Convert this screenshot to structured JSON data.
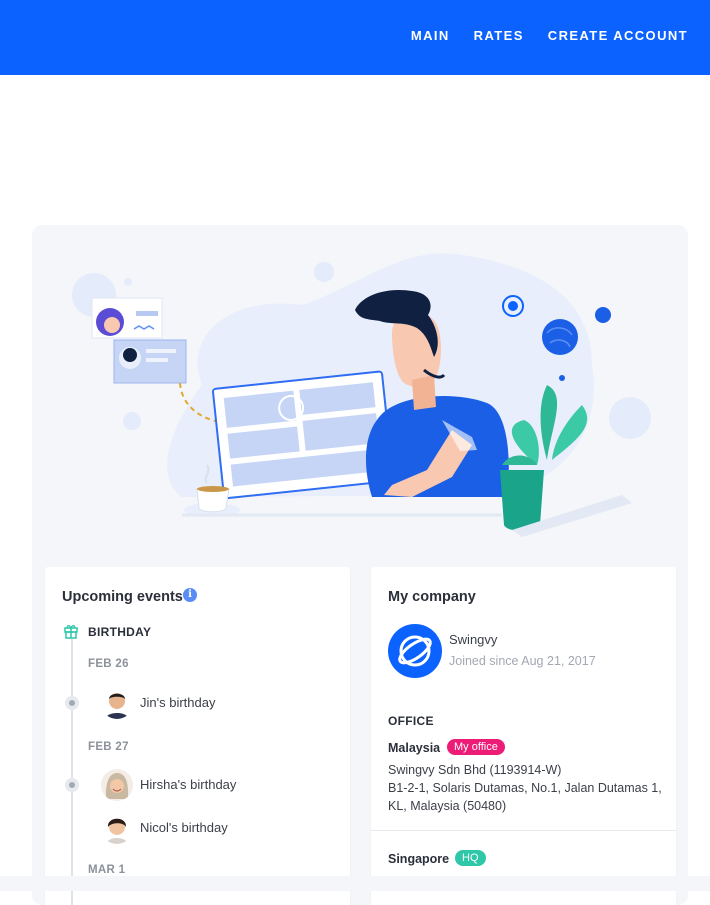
{
  "nav": {
    "items": [
      "MAIN",
      "RATES",
      "CREATE ACCOUNT"
    ]
  },
  "events": {
    "title": "Upcoming events",
    "category": "BIRTHDAY",
    "groups": [
      {
        "date": "FEB 26",
        "items": [
          "Jin's birthday"
        ]
      },
      {
        "date": "FEB 27",
        "items": [
          "Hirsha's birthday",
          "Nicol's birthday"
        ]
      },
      {
        "date": "MAR 1",
        "items": []
      }
    ]
  },
  "company": {
    "title": "My company",
    "name": "Swingvy",
    "since": "Joined since Aug 21, 2017",
    "office_heading": "OFFICE",
    "offices": [
      {
        "country": "Malaysia",
        "badge": "My office",
        "badge_color": "#ec1c77",
        "address_lines": [
          "Swingvy Sdn Bhd (1193914-W)",
          "B1-2-1, Solaris Dutamas, No.1, Jalan Dutamas 1,",
          "KL, Malaysia (50480)"
        ]
      },
      {
        "country": "Singapore",
        "badge": "HQ",
        "badge_color": "#2ec7a8"
      }
    ]
  },
  "colors": {
    "brand": "#0c62ff",
    "background": "#f4f6f9"
  }
}
